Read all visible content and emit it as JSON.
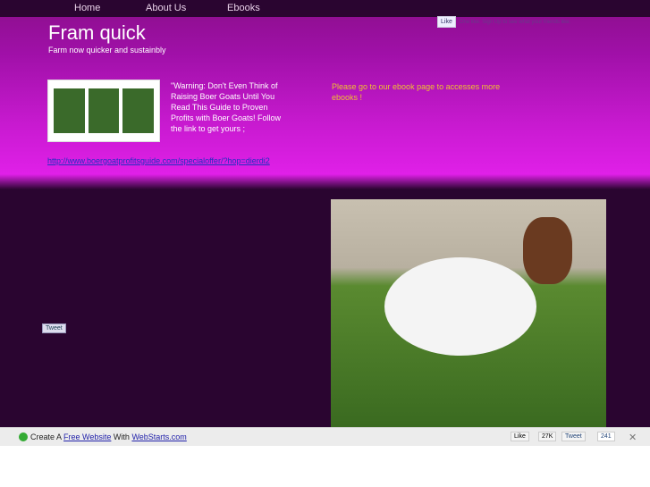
{
  "nav": {
    "items": [
      "Home",
      "About Us",
      "Ebooks"
    ]
  },
  "header": {
    "title": "Fram quick",
    "subtitle": "Farm now quicker and sustainbly"
  },
  "facebook": {
    "like_label": "Like",
    "text": "One like. Sign Up to see what your friends like."
  },
  "promo": {
    "warning": "\"Warning: Don't Even Think of Raising Boer Goats Until You Read This Guide to Proven Profits with Boer Goats! Follow the link to get yours ;",
    "link": "http://www.boergoatprofitsguide.com/specialoffer/?hop=dierdi2",
    "ebook_notice": "Please go to our ebook page to accesses more ebooks !"
  },
  "tweet_label": "Tweet",
  "footer": {
    "create": "Create A",
    "free_website": "Free Website",
    "with": "With",
    "webstarts": "WebStarts.com",
    "like": "Like",
    "like_count": "27K",
    "tweet": "Tweet",
    "tweet_count": "241",
    "close": "✕"
  }
}
